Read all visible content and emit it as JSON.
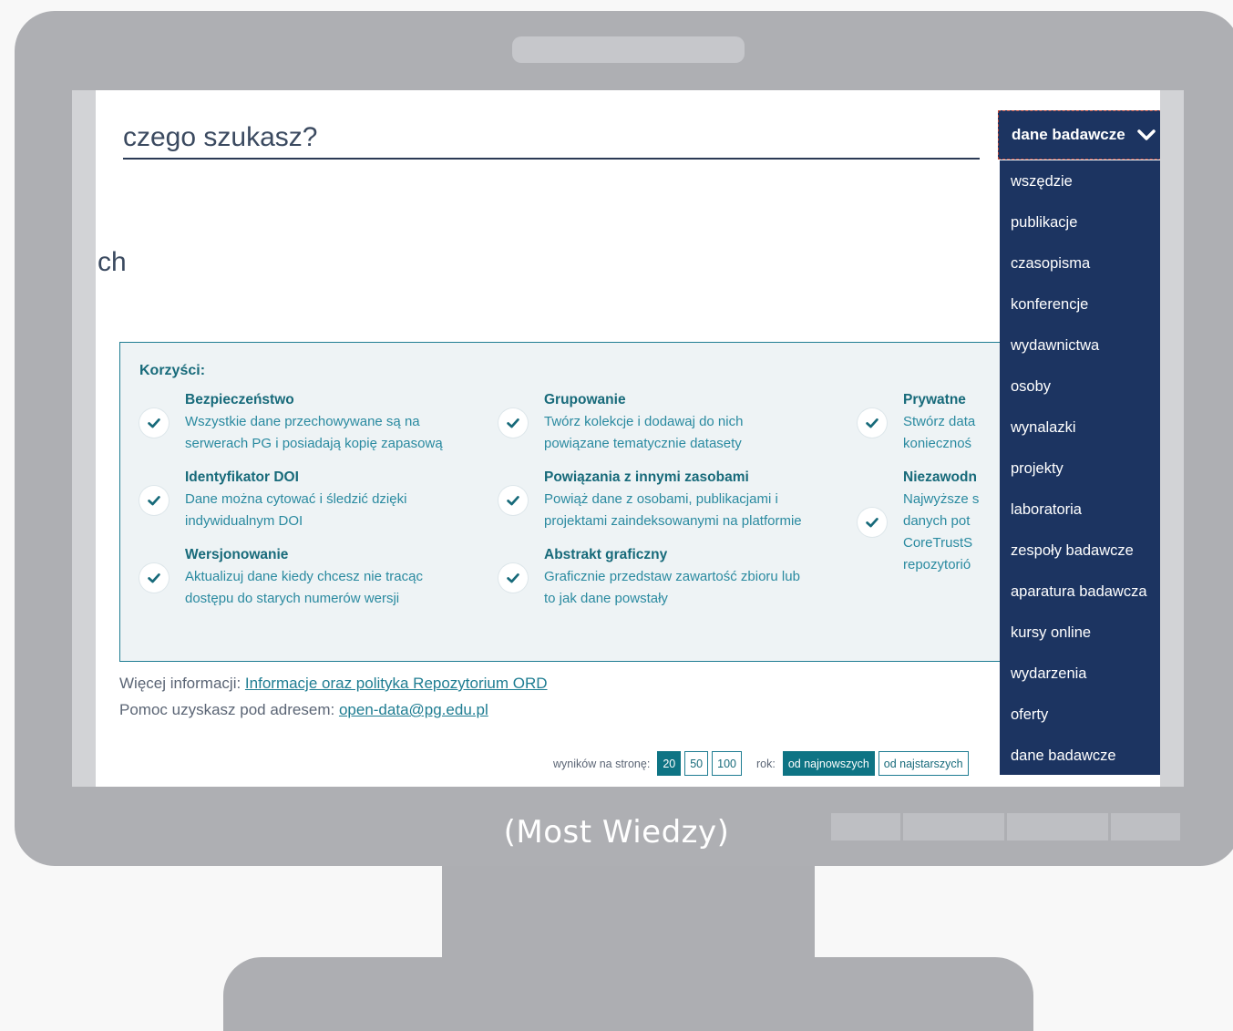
{
  "search": {
    "placeholder": "czego szukasz?"
  },
  "partial_heading": "ch",
  "dropdown": {
    "selected": "dane badawcze",
    "items": [
      "wszędzie",
      "publikacje",
      "czasopisma",
      "konferencje",
      "wydawnictwa",
      "osoby",
      "wynalazki",
      "projekty",
      "laboratoria",
      "zespoły badawcze",
      "aparatura badawcza",
      "kursy online",
      "wydarzenia",
      "oferty",
      "dane badawcze"
    ]
  },
  "benefits": {
    "title": "Korzyści:",
    "items": [
      {
        "title": "Bezpieczeństwo",
        "lines": [
          "Wszystkie dane przechowywane są na",
          "serwerach PG i posiadają kopię zapasową"
        ]
      },
      {
        "title": "Identyfikator DOI",
        "lines": [
          "Dane można cytować i śledzić dzięki",
          "indywidualnym DOI"
        ]
      },
      {
        "title": "Wersjonowanie",
        "lines": [
          "Aktualizuj dane kiedy chcesz nie tracąc",
          "dostępu do starych numerów wersji"
        ]
      },
      {
        "title": "Grupowanie",
        "lines": [
          "Twórz kolekcje i dodawaj do nich",
          "powiązane tematycznie datasety"
        ]
      },
      {
        "title": "Powiązania z innymi zasobami",
        "lines": [
          "Powiąż dane z osobami, publikacjami i",
          "projektami zaindeksowanymi na platformie"
        ]
      },
      {
        "title": "Abstrakt graficzny",
        "lines": [
          "Graficznie przedstaw zawartość zbioru lub",
          "to jak dane powstały"
        ]
      },
      {
        "title": "Prywatne",
        "lines": [
          "Stwórz data",
          "koniecznoś"
        ]
      },
      {
        "title": "Niezawodn",
        "lines": [
          "Najwyższe s",
          "danych pot",
          "CoreTrustS",
          "repozytorió"
        ]
      }
    ]
  },
  "info": {
    "more_label": "Więcej informacji: ",
    "more_link": "Informacje oraz polityka Repozytorium ORD",
    "help_label": "Pomoc uzyskasz pod adresem: ",
    "help_link": "open-data@pg.edu.pl"
  },
  "pager": {
    "per_page_label": "wyników na stronę:",
    "per_page_options": [
      "20",
      "50",
      "100"
    ],
    "active": "20",
    "year_label": "rok:",
    "sort_newest": "od najnowszych",
    "sort_oldest": "od najstarszych"
  },
  "caption": "(Most Wiedzy)",
  "colors": {
    "navy": "#1c3461",
    "teal": "#176a7a",
    "monitor": "#aeafb3"
  }
}
